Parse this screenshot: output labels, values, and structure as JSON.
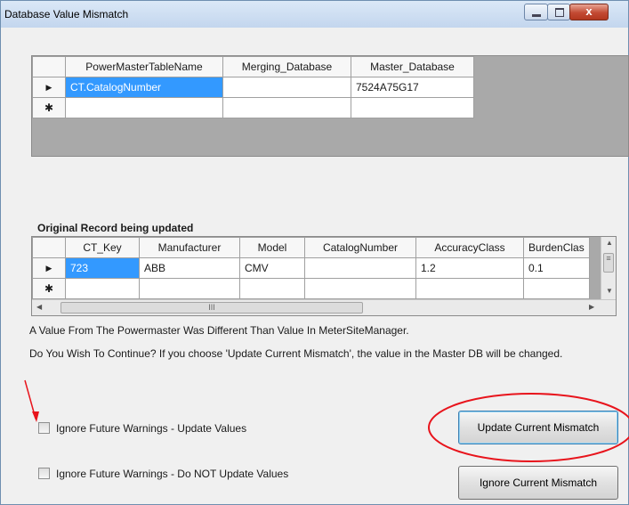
{
  "window": {
    "title": "Database Value  Mismatch",
    "close_glyph": "x"
  },
  "mismatch_grid": {
    "columns": [
      "PowerMasterTableName",
      "Merging_Database",
      "Master_Database"
    ],
    "rows": [
      {
        "marker": "▶",
        "cells": [
          "CT.CatalogNumber",
          "",
          "7524A75G17"
        ]
      },
      {
        "marker": "✱",
        "cells": [
          "",
          "",
          ""
        ]
      }
    ]
  },
  "original_record": {
    "label": "Original Record being updated",
    "columns": [
      "CT_Key",
      "Manufacturer",
      "Model",
      "CatalogNumber",
      "AccuracyClass",
      "BurdenClas"
    ],
    "rows": [
      {
        "marker": "▶",
        "cells": [
          "723",
          "ABB",
          "CMV",
          "",
          "1.2",
          "0.1"
        ]
      },
      {
        "marker": "✱",
        "cells": [
          "",
          "",
          "",
          "",
          "",
          ""
        ]
      }
    ],
    "scroll_thumb_grip": "III"
  },
  "messages": {
    "line1": "A Value From The Powermaster Was Different Than Value In MeterSiteManager.",
    "line2": "Do You Wish To Continue?  If you choose 'Update Current Mismatch', the value in the Master DB will be changed."
  },
  "options": {
    "ignore_update_label": "Ignore Future Warnings - Update Values",
    "ignore_no_update_label": "Ignore Future Warnings - Do NOT Update Values"
  },
  "buttons": {
    "update_current": "Update Current Mismatch",
    "ignore_current": "Ignore Current Mismatch"
  },
  "colors": {
    "selection": "#3399ff",
    "annotation": "#e8141c",
    "grid_background": "#a9a9a9"
  }
}
